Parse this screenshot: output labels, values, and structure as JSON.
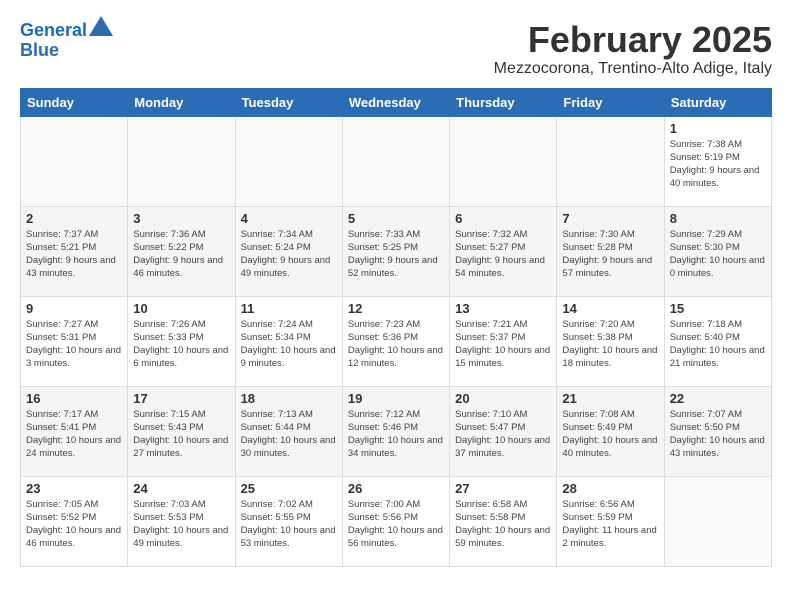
{
  "logo": {
    "line1": "General",
    "line2": "Blue"
  },
  "title": "February 2025",
  "location": "Mezzocorona, Trentino-Alto Adige, Italy",
  "days_of_week": [
    "Sunday",
    "Monday",
    "Tuesday",
    "Wednesday",
    "Thursday",
    "Friday",
    "Saturday"
  ],
  "weeks": [
    [
      {
        "day": "",
        "info": ""
      },
      {
        "day": "",
        "info": ""
      },
      {
        "day": "",
        "info": ""
      },
      {
        "day": "",
        "info": ""
      },
      {
        "day": "",
        "info": ""
      },
      {
        "day": "",
        "info": ""
      },
      {
        "day": "1",
        "info": "Sunrise: 7:38 AM\nSunset: 5:19 PM\nDaylight: 9 hours and 40 minutes."
      }
    ],
    [
      {
        "day": "2",
        "info": "Sunrise: 7:37 AM\nSunset: 5:21 PM\nDaylight: 9 hours and 43 minutes."
      },
      {
        "day": "3",
        "info": "Sunrise: 7:36 AM\nSunset: 5:22 PM\nDaylight: 9 hours and 46 minutes."
      },
      {
        "day": "4",
        "info": "Sunrise: 7:34 AM\nSunset: 5:24 PM\nDaylight: 9 hours and 49 minutes."
      },
      {
        "day": "5",
        "info": "Sunrise: 7:33 AM\nSunset: 5:25 PM\nDaylight: 9 hours and 52 minutes."
      },
      {
        "day": "6",
        "info": "Sunrise: 7:32 AM\nSunset: 5:27 PM\nDaylight: 9 hours and 54 minutes."
      },
      {
        "day": "7",
        "info": "Sunrise: 7:30 AM\nSunset: 5:28 PM\nDaylight: 9 hours and 57 minutes."
      },
      {
        "day": "8",
        "info": "Sunrise: 7:29 AM\nSunset: 5:30 PM\nDaylight: 10 hours and 0 minutes."
      }
    ],
    [
      {
        "day": "9",
        "info": "Sunrise: 7:27 AM\nSunset: 5:31 PM\nDaylight: 10 hours and 3 minutes."
      },
      {
        "day": "10",
        "info": "Sunrise: 7:26 AM\nSunset: 5:33 PM\nDaylight: 10 hours and 6 minutes."
      },
      {
        "day": "11",
        "info": "Sunrise: 7:24 AM\nSunset: 5:34 PM\nDaylight: 10 hours and 9 minutes."
      },
      {
        "day": "12",
        "info": "Sunrise: 7:23 AM\nSunset: 5:36 PM\nDaylight: 10 hours and 12 minutes."
      },
      {
        "day": "13",
        "info": "Sunrise: 7:21 AM\nSunset: 5:37 PM\nDaylight: 10 hours and 15 minutes."
      },
      {
        "day": "14",
        "info": "Sunrise: 7:20 AM\nSunset: 5:38 PM\nDaylight: 10 hours and 18 minutes."
      },
      {
        "day": "15",
        "info": "Sunrise: 7:18 AM\nSunset: 5:40 PM\nDaylight: 10 hours and 21 minutes."
      }
    ],
    [
      {
        "day": "16",
        "info": "Sunrise: 7:17 AM\nSunset: 5:41 PM\nDaylight: 10 hours and 24 minutes."
      },
      {
        "day": "17",
        "info": "Sunrise: 7:15 AM\nSunset: 5:43 PM\nDaylight: 10 hours and 27 minutes."
      },
      {
        "day": "18",
        "info": "Sunrise: 7:13 AM\nSunset: 5:44 PM\nDaylight: 10 hours and 30 minutes."
      },
      {
        "day": "19",
        "info": "Sunrise: 7:12 AM\nSunset: 5:46 PM\nDaylight: 10 hours and 34 minutes."
      },
      {
        "day": "20",
        "info": "Sunrise: 7:10 AM\nSunset: 5:47 PM\nDaylight: 10 hours and 37 minutes."
      },
      {
        "day": "21",
        "info": "Sunrise: 7:08 AM\nSunset: 5:49 PM\nDaylight: 10 hours and 40 minutes."
      },
      {
        "day": "22",
        "info": "Sunrise: 7:07 AM\nSunset: 5:50 PM\nDaylight: 10 hours and 43 minutes."
      }
    ],
    [
      {
        "day": "23",
        "info": "Sunrise: 7:05 AM\nSunset: 5:52 PM\nDaylight: 10 hours and 46 minutes."
      },
      {
        "day": "24",
        "info": "Sunrise: 7:03 AM\nSunset: 5:53 PM\nDaylight: 10 hours and 49 minutes."
      },
      {
        "day": "25",
        "info": "Sunrise: 7:02 AM\nSunset: 5:55 PM\nDaylight: 10 hours and 53 minutes."
      },
      {
        "day": "26",
        "info": "Sunrise: 7:00 AM\nSunset: 5:56 PM\nDaylight: 10 hours and 56 minutes."
      },
      {
        "day": "27",
        "info": "Sunrise: 6:58 AM\nSunset: 5:58 PM\nDaylight: 10 hours and 59 minutes."
      },
      {
        "day": "28",
        "info": "Sunrise: 6:56 AM\nSunset: 5:59 PM\nDaylight: 11 hours and 2 minutes."
      },
      {
        "day": "",
        "info": ""
      }
    ]
  ]
}
